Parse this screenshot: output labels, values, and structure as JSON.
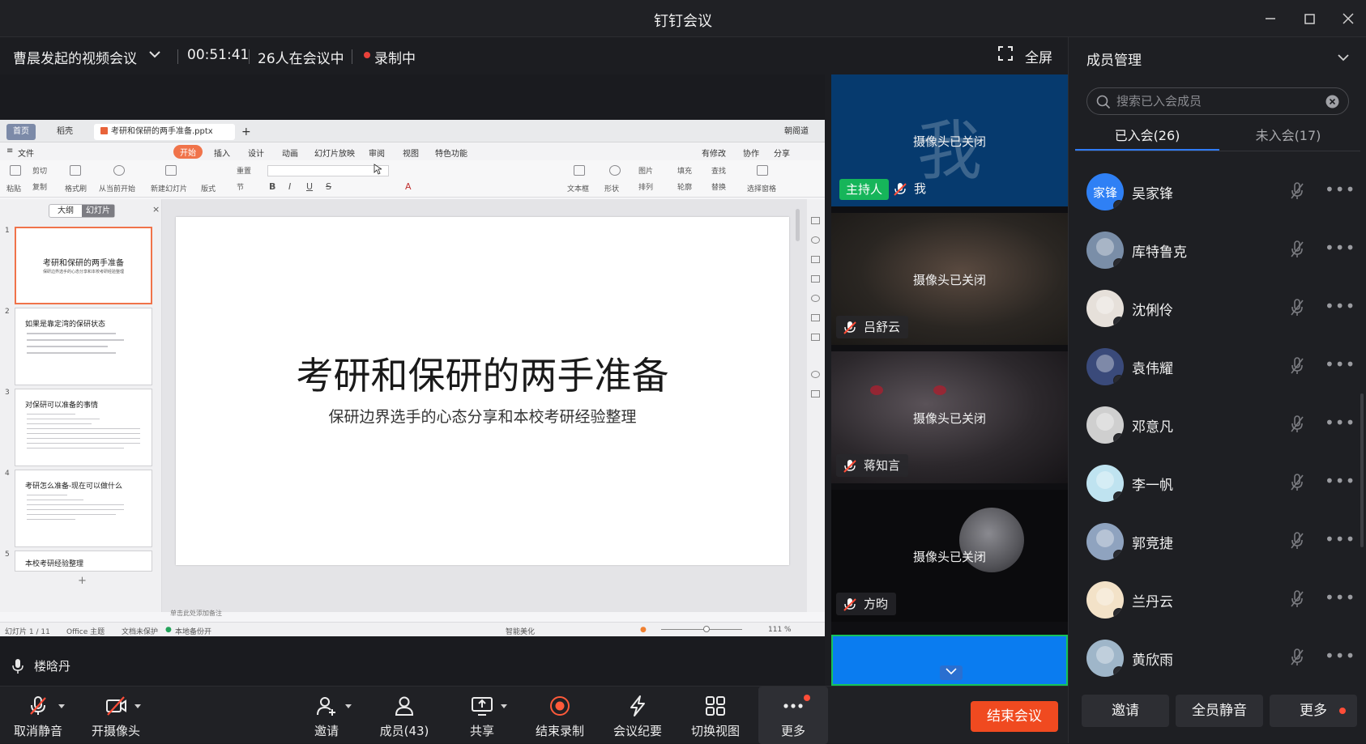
{
  "app": {
    "title": "钉钉会议"
  },
  "meeting": {
    "name": "曹晨发起的视频会议",
    "timer": "00:51:41",
    "attendees": "26人在会议中",
    "recording": "录制中",
    "fullscreen": "全屏"
  },
  "share": {
    "tabs": [
      "首页",
      "稻壳",
      "考研和保研的两手准备.pptx"
    ],
    "user_chip": "朝阁道",
    "menu": [
      "文件",
      "开始",
      "插入",
      "设计",
      "动画",
      "幻灯片放映",
      "审阅",
      "视图",
      "特色功能"
    ],
    "menu_right": [
      "有修改",
      "协作",
      "分享"
    ],
    "ribbon": [
      "粘贴",
      "剪切",
      "复制",
      "格式刷",
      "从当前开始",
      "新建幻灯片",
      "版式",
      "重置",
      "节",
      "文本框",
      "形状",
      "图片",
      "排列",
      "填充",
      "轮廓",
      "查找",
      "替换",
      "选择窗格"
    ],
    "pane_tabs": [
      "大纲",
      "幻灯片"
    ],
    "thumbs": [
      {
        "num": "1",
        "title": "考研和保研的两手准备",
        "subtitle": "保研边界选手的心态分享和本校考研经验整理"
      },
      {
        "num": "2",
        "title": "如果是靠定湾的保研状态"
      },
      {
        "num": "3",
        "title": "对保研可以准备的事情"
      },
      {
        "num": "4",
        "title": "考研怎么准备-现在可以做什么"
      },
      {
        "num": "5",
        "title": "本校考研经验整理"
      }
    ],
    "slide_title": "考研和保研的两手准备",
    "slide_subtitle": "保研边界选手的心态分享和本校考研经验整理",
    "notes_hint": "单击此处添加备注",
    "status": {
      "slide_no": "幻灯片 1 / 11",
      "theme": "Office 主题",
      "protect": "文档未保护",
      "backup": "本地备份开",
      "smart": "智能美化",
      "zoom": "111 %"
    }
  },
  "speaker": "楼晗丹",
  "tiles": [
    {
      "cam": "摄像头已关闭",
      "host_badge": "主持人",
      "name": "我",
      "bg_char": "我"
    },
    {
      "cam": "摄像头已关闭",
      "name": "吕舒云"
    },
    {
      "cam": "摄像头已关闭",
      "name": "蒋知言"
    },
    {
      "cam": "摄像头已关闭",
      "name": "方昀"
    }
  ],
  "members_panel": {
    "title": "成员管理",
    "search_placeholder": "搜索已入会成员",
    "tab_joined": "已入会(26)",
    "tab_not_joined": "未入会(17)",
    "members": [
      {
        "name": "吴家锋",
        "avatar_text": "家锋",
        "color": "#2f80f5"
      },
      {
        "name": "库特鲁克",
        "avatar_text": "",
        "color": "#7a8ea8"
      },
      {
        "name": "沈俐伶",
        "avatar_text": "",
        "color": "#e6e0da"
      },
      {
        "name": "袁伟耀",
        "avatar_text": "",
        "color": "#3a4a7a"
      },
      {
        "name": "邓意凡",
        "avatar_text": "",
        "color": "#cfcfcf"
      },
      {
        "name": "李一帆",
        "avatar_text": "",
        "color": "#bfe3f0"
      },
      {
        "name": "郭竞捷",
        "avatar_text": "",
        "color": "#8fa3bf"
      },
      {
        "name": "兰丹云",
        "avatar_text": "",
        "color": "#f3e2c8"
      },
      {
        "name": "黄欣雨",
        "avatar_text": "",
        "color": "#9fb6c9"
      }
    ],
    "buttons": [
      "邀请",
      "全员静音",
      "更多"
    ]
  },
  "toolbar": {
    "unmute": "取消静音",
    "camera": "开摄像头",
    "invite": "邀请",
    "members": "成员(43)",
    "share": "共享",
    "stop_record": "结束录制",
    "minutes": "会议纪要",
    "switch_view": "切换视图",
    "more": "更多",
    "end": "结束会议"
  },
  "colors": {
    "accent": "#2f7bf5",
    "end": "#f04a20",
    "host": "#16b55a",
    "record": "#e8413a"
  }
}
